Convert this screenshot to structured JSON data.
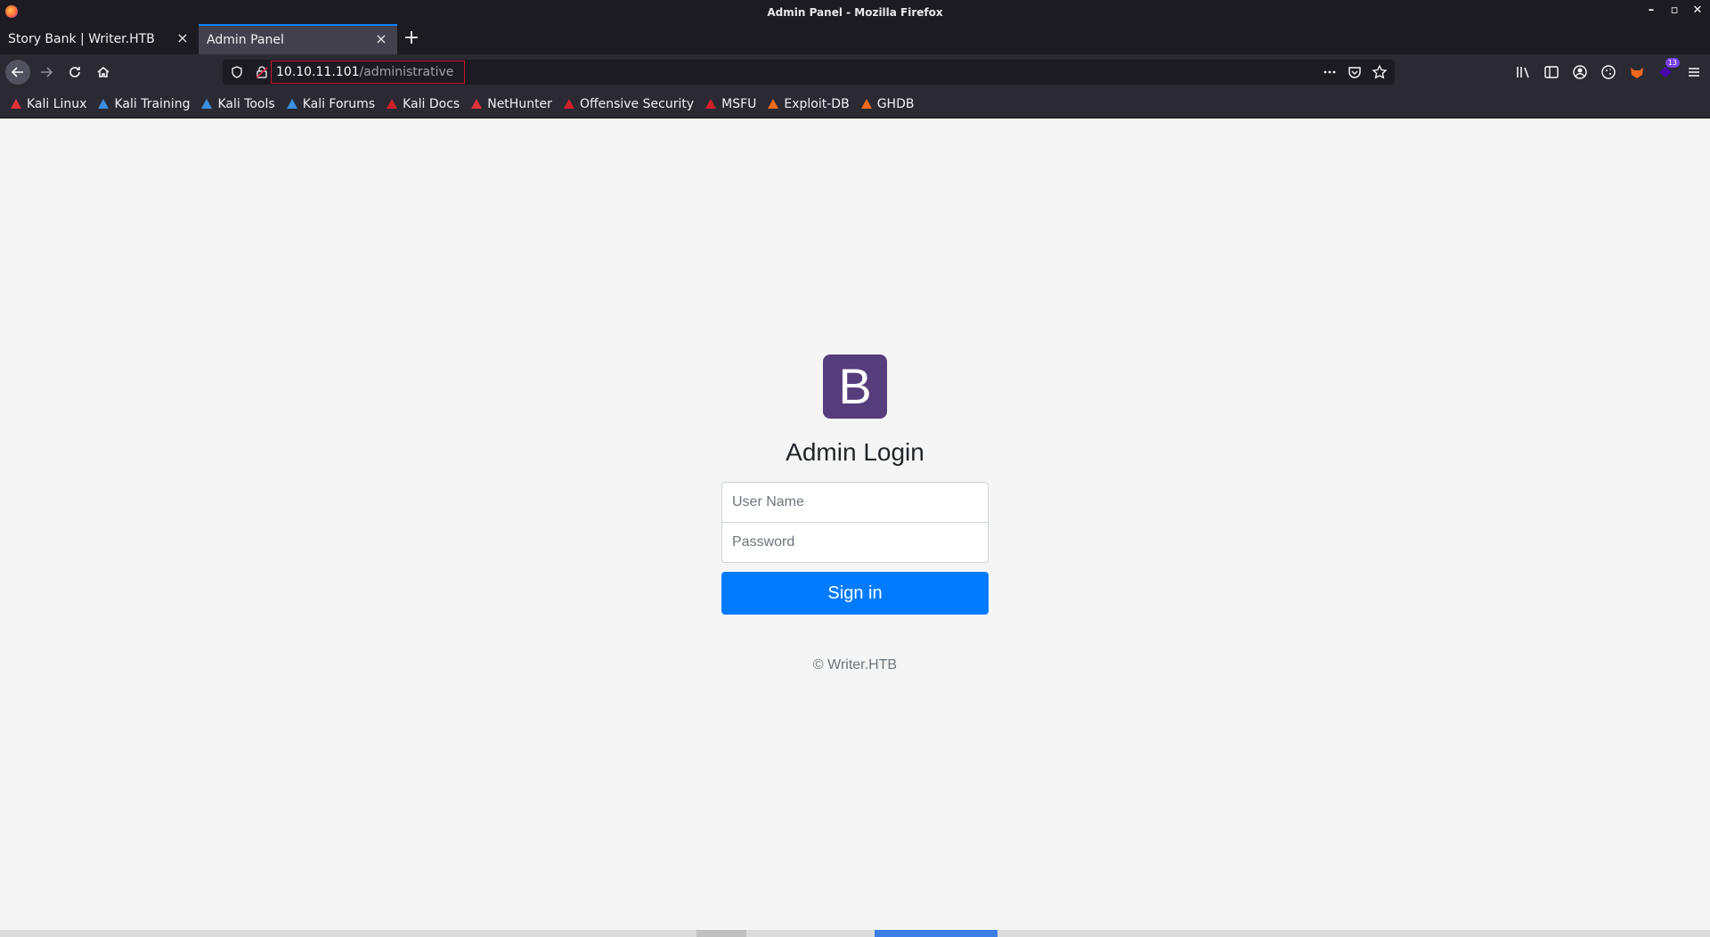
{
  "window": {
    "title": "Admin Panel - Mozilla Firefox",
    "controls": [
      "–",
      "▫",
      "✕"
    ]
  },
  "tabs": [
    {
      "label": "Story Bank | Writer.HTB",
      "active": false
    },
    {
      "label": "Admin Panel",
      "active": true
    }
  ],
  "newtab_label": "+",
  "urlbar": {
    "host": "10.10.11.101",
    "path": "/administrative"
  },
  "toolbar_badge": "13",
  "bookmarks": [
    {
      "label": "Kali Linux",
      "icon": "kali-dragon-icon",
      "color": "#e2333b"
    },
    {
      "label": "Kali Training",
      "icon": "kali-training-icon",
      "color": "#3b8fe0"
    },
    {
      "label": "Kali Tools",
      "icon": "kali-tools-icon",
      "color": "#3b8fe0"
    },
    {
      "label": "Kali Forums",
      "icon": "kali-forums-icon",
      "color": "#3b8fe0"
    },
    {
      "label": "Kali Docs",
      "icon": "kali-docs-icon",
      "color": "#d0202a"
    },
    {
      "label": "NetHunter",
      "icon": "nethunter-icon",
      "color": "#e2333b"
    },
    {
      "label": "Offensive Security",
      "icon": "offsec-icon",
      "color": "#d0202a"
    },
    {
      "label": "MSFU",
      "icon": "msfu-icon",
      "color": "#d0202a"
    },
    {
      "label": "Exploit-DB",
      "icon": "exploit-db-icon",
      "color": "#f06a1e"
    },
    {
      "label": "GHDB",
      "icon": "ghdb-icon",
      "color": "#f06a1e"
    }
  ],
  "login": {
    "logo_letter": "B",
    "title": "Admin Login",
    "username_placeholder": "User Name",
    "password_placeholder": "Password",
    "submit_label": "Sign in",
    "copyright": "© Writer.HTB"
  },
  "colors": {
    "logo_bg": "#563d7c",
    "button_bg": "#007bff",
    "page_bg": "#f5f5f5"
  }
}
